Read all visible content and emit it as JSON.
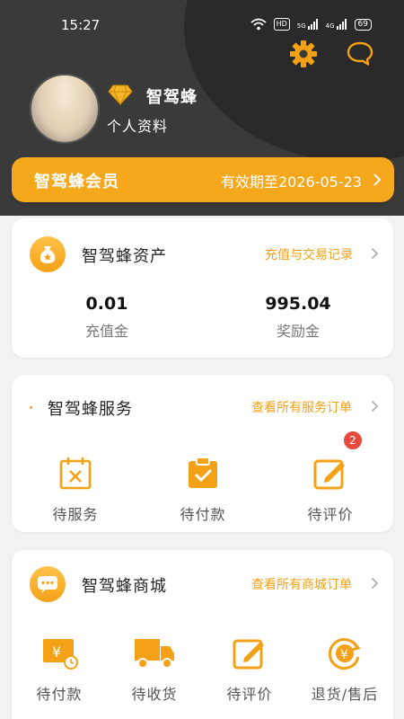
{
  "status_bar": {
    "time": "15:27",
    "hd_label": "HD",
    "network_a": "5G",
    "network_b": "4G",
    "battery": "69"
  },
  "header": {
    "username": "智驾蜂",
    "profile_link": "个人资料",
    "settings_icon": "gear-icon",
    "message_icon": "chat-bubble-icon"
  },
  "membership": {
    "title": "智驾蜂会员",
    "expiry": "有效期至2026-05-23"
  },
  "assets": {
    "title": "智驾蜂资产",
    "link": "充值与交易记录",
    "items": [
      {
        "value": "0.01",
        "label": "充值金"
      },
      {
        "value": "995.04",
        "label": "奖励金"
      }
    ]
  },
  "services": {
    "title": "智驾蜂服务",
    "link": "查看所有服务订单",
    "items": [
      {
        "label": "待服务",
        "icon": "calendar-x-icon"
      },
      {
        "label": "待付款",
        "icon": "clipboard-check-icon"
      },
      {
        "label": "待评价",
        "icon": "edit-note-icon",
        "badge": "2"
      }
    ]
  },
  "mall": {
    "title": "智驾蜂商城",
    "link": "查看所有商城订单",
    "items": [
      {
        "label": "待付款",
        "icon": "yen-card-icon"
      },
      {
        "label": "待收货",
        "icon": "truck-icon"
      },
      {
        "label": "待评价",
        "icon": "edit-note-icon"
      },
      {
        "label": "退货/售后",
        "icon": "yen-refund-icon"
      }
    ]
  },
  "colors": {
    "accent": "#f6a81c",
    "header_bg": "#3a3a3a",
    "badge": "#e84a3f"
  }
}
